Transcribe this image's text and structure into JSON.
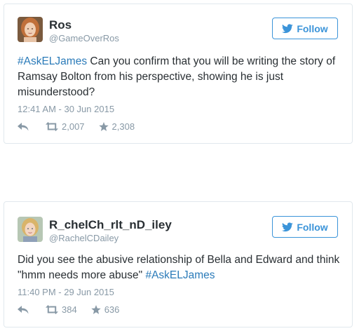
{
  "colors": {
    "link": "#2b7bb9",
    "follow_accent": "#3b94d9",
    "meta_gray": "#8899a6",
    "text": "#292f33",
    "border": "#e1e8ed"
  },
  "tweets": [
    {
      "name": "Ros",
      "handle": "@GameOverRos",
      "follow_label": "Follow",
      "follow_icon": "twitter-bird-icon",
      "hashtag": "#AskELJames",
      "text_before": "",
      "text_after": " Can you confirm that you will be writing the story of Ramsay Bolton from his perspective, showing he is just misunderstood?",
      "timestamp": "12:41 AM - 30 Jun 2015",
      "reply_icon": "reply-icon",
      "retweet_icon": "retweet-icon",
      "retweet_count": "2,007",
      "favorite_icon": "star-icon",
      "favorite_count": "2,308"
    },
    {
      "name": "R_chelCh_rlt_nD_iley",
      "handle": "@RachelCDailey",
      "follow_label": "Follow",
      "follow_icon": "twitter-bird-icon",
      "hashtag": "#AskELJames",
      "text_before": "Did you see the abusive relationship of Bella and Edward and think \"hmm needs more abuse\" ",
      "text_after": "",
      "timestamp": "11:40 PM - 29 Jun 2015",
      "reply_icon": "reply-icon",
      "retweet_icon": "retweet-icon",
      "retweet_count": "384",
      "favorite_icon": "star-icon",
      "favorite_count": "636"
    }
  ]
}
